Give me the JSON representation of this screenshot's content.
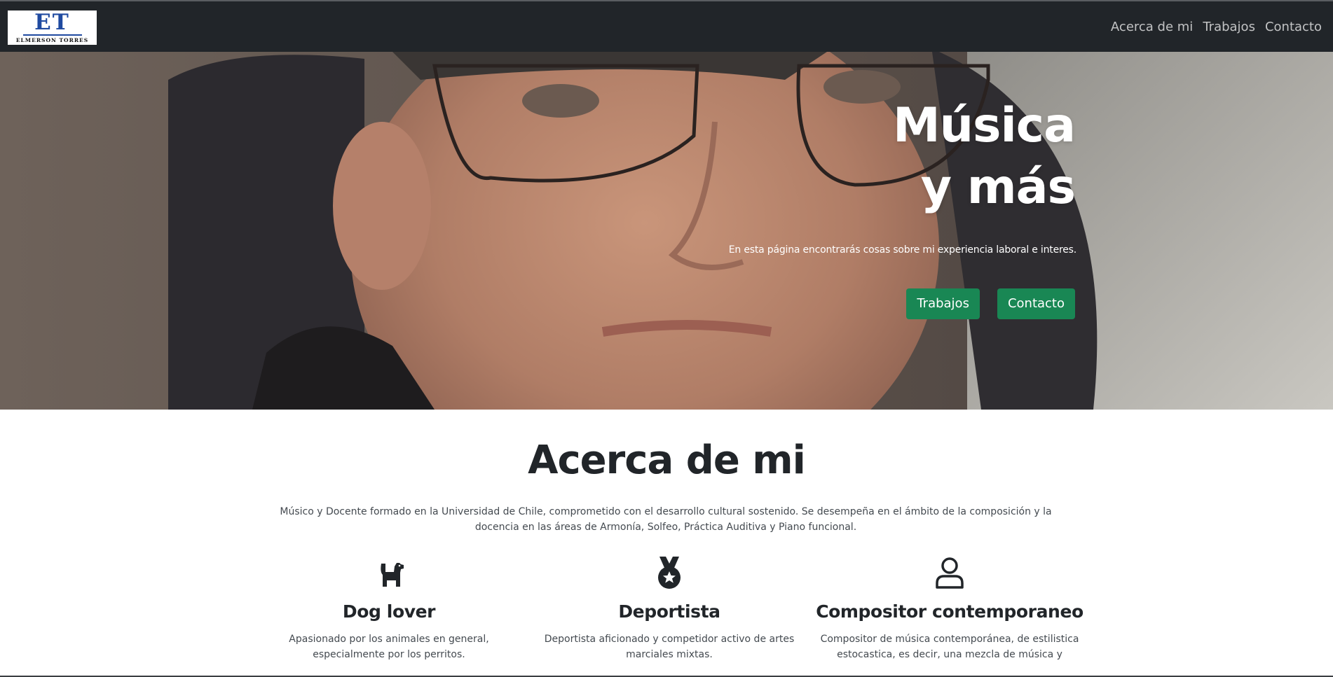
{
  "brand": {
    "logo_mark": "ET",
    "logo_name": "ELMERSON TORRES"
  },
  "nav": {
    "items": [
      {
        "label": "Acerca de mi"
      },
      {
        "label": "Trabajos"
      },
      {
        "label": "Contacto"
      }
    ]
  },
  "hero": {
    "title_line1": "Música",
    "title_line2": "y más",
    "subtitle": "En esta página encontrarás cosas sobre mi experiencia laboral e interes.",
    "buttons": [
      {
        "label": "Trabajos"
      },
      {
        "label": "Contacto"
      }
    ],
    "button_color": "#198754"
  },
  "about": {
    "title": "Acerca de mi",
    "text": "Músico y Docente formado en la Universidad de Chile, comprometido con el desarrollo cultural sostenido. Se desempeña en el ámbito de la composición y la docencia en las áreas de Armonía, Solfeo, Práctica Auditiva y Piano funcional.",
    "features": [
      {
        "icon": "dog-icon",
        "title": "Dog lover",
        "text": "Apasionado por los animales en general, especialmente por los perritos."
      },
      {
        "icon": "medal-icon",
        "title": "Deportista",
        "text": "Deportista aficionado y competidor activo de artes marciales mixtas."
      },
      {
        "icon": "user-icon",
        "title": "Compositor contemporaneo",
        "text": "Compositor de música contemporánea, de estilistica estocastica, es decir, una mezcla de música y"
      }
    ]
  },
  "colors": {
    "navbar": "#212529",
    "accent": "#198754",
    "text": "#212529"
  }
}
